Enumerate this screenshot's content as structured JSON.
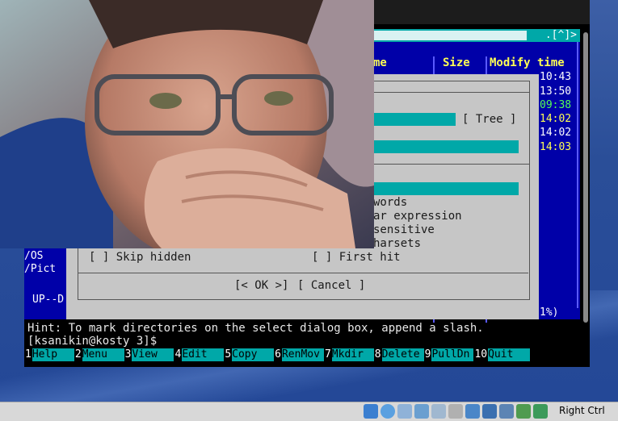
{
  "mc": {
    "corner_buttons": ".[^]>",
    "columns": {
      "name": "me",
      "size": "Size",
      "modify_time": "Modify time"
    },
    "times": [
      {
        "value": "10:43",
        "tone": "white"
      },
      {
        "value": "13:50",
        "tone": "white"
      },
      {
        "value": "09:38",
        "tone": "green"
      },
      {
        "value": "14:02",
        "tone": "yellow"
      },
      {
        "value": "14:02",
        "tone": "white"
      },
      {
        "value": "14:03",
        "tone": "yellow"
      }
    ],
    "left_panel_items": [
      "/OS",
      "/Pict"
    ],
    "up_dir": "UP--D",
    "percent": "1%)"
  },
  "dialog": {
    "tree_button": "[ Tree ]",
    "options_partial": [
      "words",
      "ar expression",
      "sensitive",
      "harsets"
    ],
    "skip_hidden": "[ ] Skip hidden",
    "first_hit": "[ ] First hit",
    "ok_button": "[< OK >]",
    "cancel_button": "[ Cancel ]"
  },
  "hint": "Hint: To mark directories on the select dialog box, append a slash.",
  "prompt": "[ksanikin@kosty 3]$",
  "fkeys": [
    {
      "num": "1",
      "label": "Help"
    },
    {
      "num": "2",
      "label": "Menu"
    },
    {
      "num": "3",
      "label": "View"
    },
    {
      "num": "4",
      "label": "Edit"
    },
    {
      "num": "5",
      "label": "Copy"
    },
    {
      "num": "6",
      "label": "RenMov"
    },
    {
      "num": "7",
      "label": "Mkdir"
    },
    {
      "num": "8",
      "label": "Delete"
    },
    {
      "num": "9",
      "label": "PullDn"
    },
    {
      "num": "10",
      "label": "Quit"
    }
  ],
  "statusbar": {
    "host_key": "Right Ctrl",
    "tray_icons": [
      "hard-disk-icon",
      "optical-drive-icon",
      "audio-icon",
      "network-icon",
      "usb-icon",
      "shared-folder-icon",
      "display-icon",
      "recording-icon",
      "cpu-icon",
      "mouse-integration-icon",
      "arrow-icon"
    ]
  },
  "colors": {
    "mc_blue": "#0000a8",
    "mc_cyan": "#00a8a8",
    "dialog_gray": "#c6c6c6",
    "highlight_yellow": "#ffff54",
    "highlight_green": "#54ff54"
  }
}
